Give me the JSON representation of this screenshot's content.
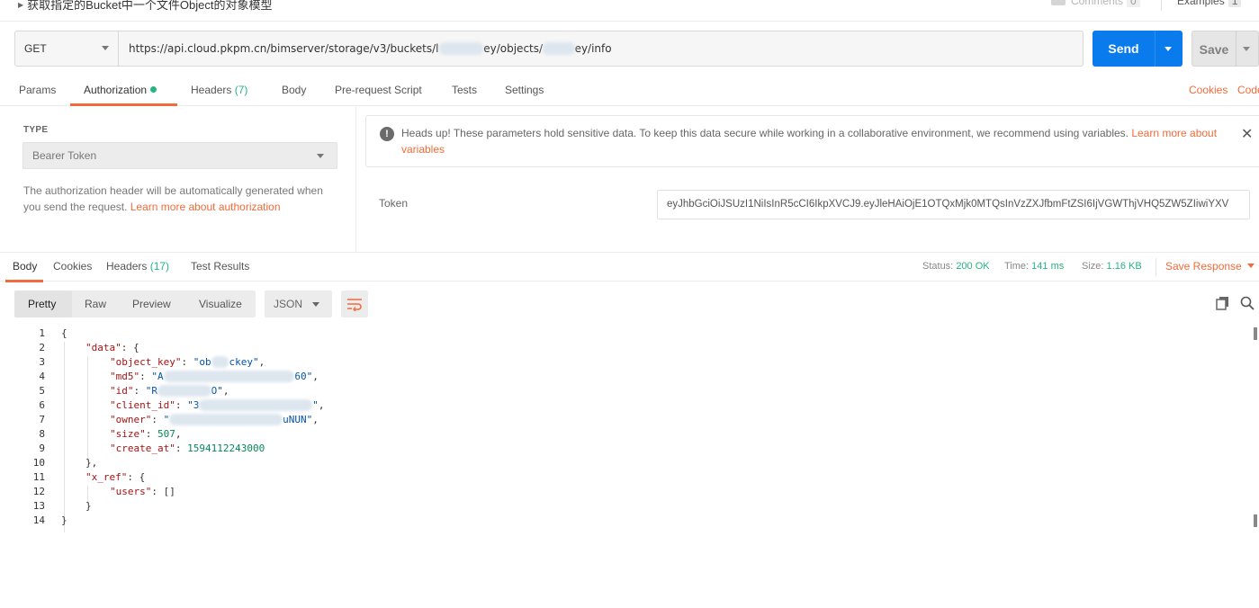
{
  "request": {
    "title": "获取指定的Bucket中一个文件Object的对象模型",
    "comments_label": "Comments",
    "comments_count": "0",
    "examples_label": "Examples",
    "examples_count": "1"
  },
  "url_bar": {
    "method": "GET",
    "url_prefix": "https://api.cloud.pkpm.cn/bimserver/storage/v3/buckets/l",
    "url_mid": "ey/objects/",
    "url_suffix": "ey/info",
    "send_label": "Send",
    "save_label": "Save"
  },
  "request_tabs": [
    {
      "label": "Params"
    },
    {
      "label": "Authorization"
    },
    {
      "label": "Headers",
      "count": "(7)"
    },
    {
      "label": "Body"
    },
    {
      "label": "Pre-request Script"
    },
    {
      "label": "Tests"
    },
    {
      "label": "Settings"
    }
  ],
  "right_links": {
    "cookies": "Cookies",
    "code": "Code"
  },
  "auth": {
    "type_label": "TYPE",
    "type_value": "Bearer Token",
    "description": "The authorization header will be automatically generated when you send the request. ",
    "learn_more": "Learn more about authorization",
    "warning_text": "Heads up! These parameters hold sensitive data. To keep this data secure while working in a collaborative environment, we recommend using variables. ",
    "warning_link": "Learn more about variables",
    "token_label": "Token",
    "token_value": "eyJhbGciOiJSUzI1NiIsInR5cCI6IkpXVCJ9.eyJleHAiOjE1OTQxMjk0MTQsInVzZXJfbmFtZSI6IjVGWThjVHQ5ZW5ZIiwiYXV"
  },
  "response": {
    "tabs": [
      {
        "label": "Body"
      },
      {
        "label": "Cookies"
      },
      {
        "label": "Headers",
        "count": "(17)"
      },
      {
        "label": "Test Results"
      }
    ],
    "status_label": "Status:",
    "status_value": "200 OK",
    "time_label": "Time:",
    "time_value": "141 ms",
    "size_label": "Size:",
    "size_value": "1.16 KB",
    "save_response": "Save Response",
    "view_modes": [
      "Pretty",
      "Raw",
      "Preview",
      "Visualize"
    ],
    "format": "JSON"
  },
  "body_lines": {
    "l1": "{",
    "l2_key": "\"data\"",
    "l2_rest": ": {",
    "l3_key": "\"object_key\"",
    "l3_val": "\"ob",
    "l3_val_end": "ckey\"",
    "l4_key": "\"md5\"",
    "l4_val": "\"A",
    "l4_val_end": "60\"",
    "l5_key": "\"id\"",
    "l5_val": "\"R",
    "l5_val_end": "O\"",
    "l6_key": "\"client_id\"",
    "l6_val": "\"3",
    "l6_val_end": "\"",
    "l7_key": "\"owner\"",
    "l7_val": "\"",
    "l7_val_end": "uNUN\"",
    "l8_key": "\"size\"",
    "l8_val": "507",
    "l9_key": "\"create_at\"",
    "l9_val": "1594112243000",
    "l10": "},",
    "l11_key": "\"x_ref\"",
    "l11_rest": ": {",
    "l12_key": "\"users\"",
    "l12_rest": ": []",
    "l13": "}",
    "l14": "}"
  }
}
